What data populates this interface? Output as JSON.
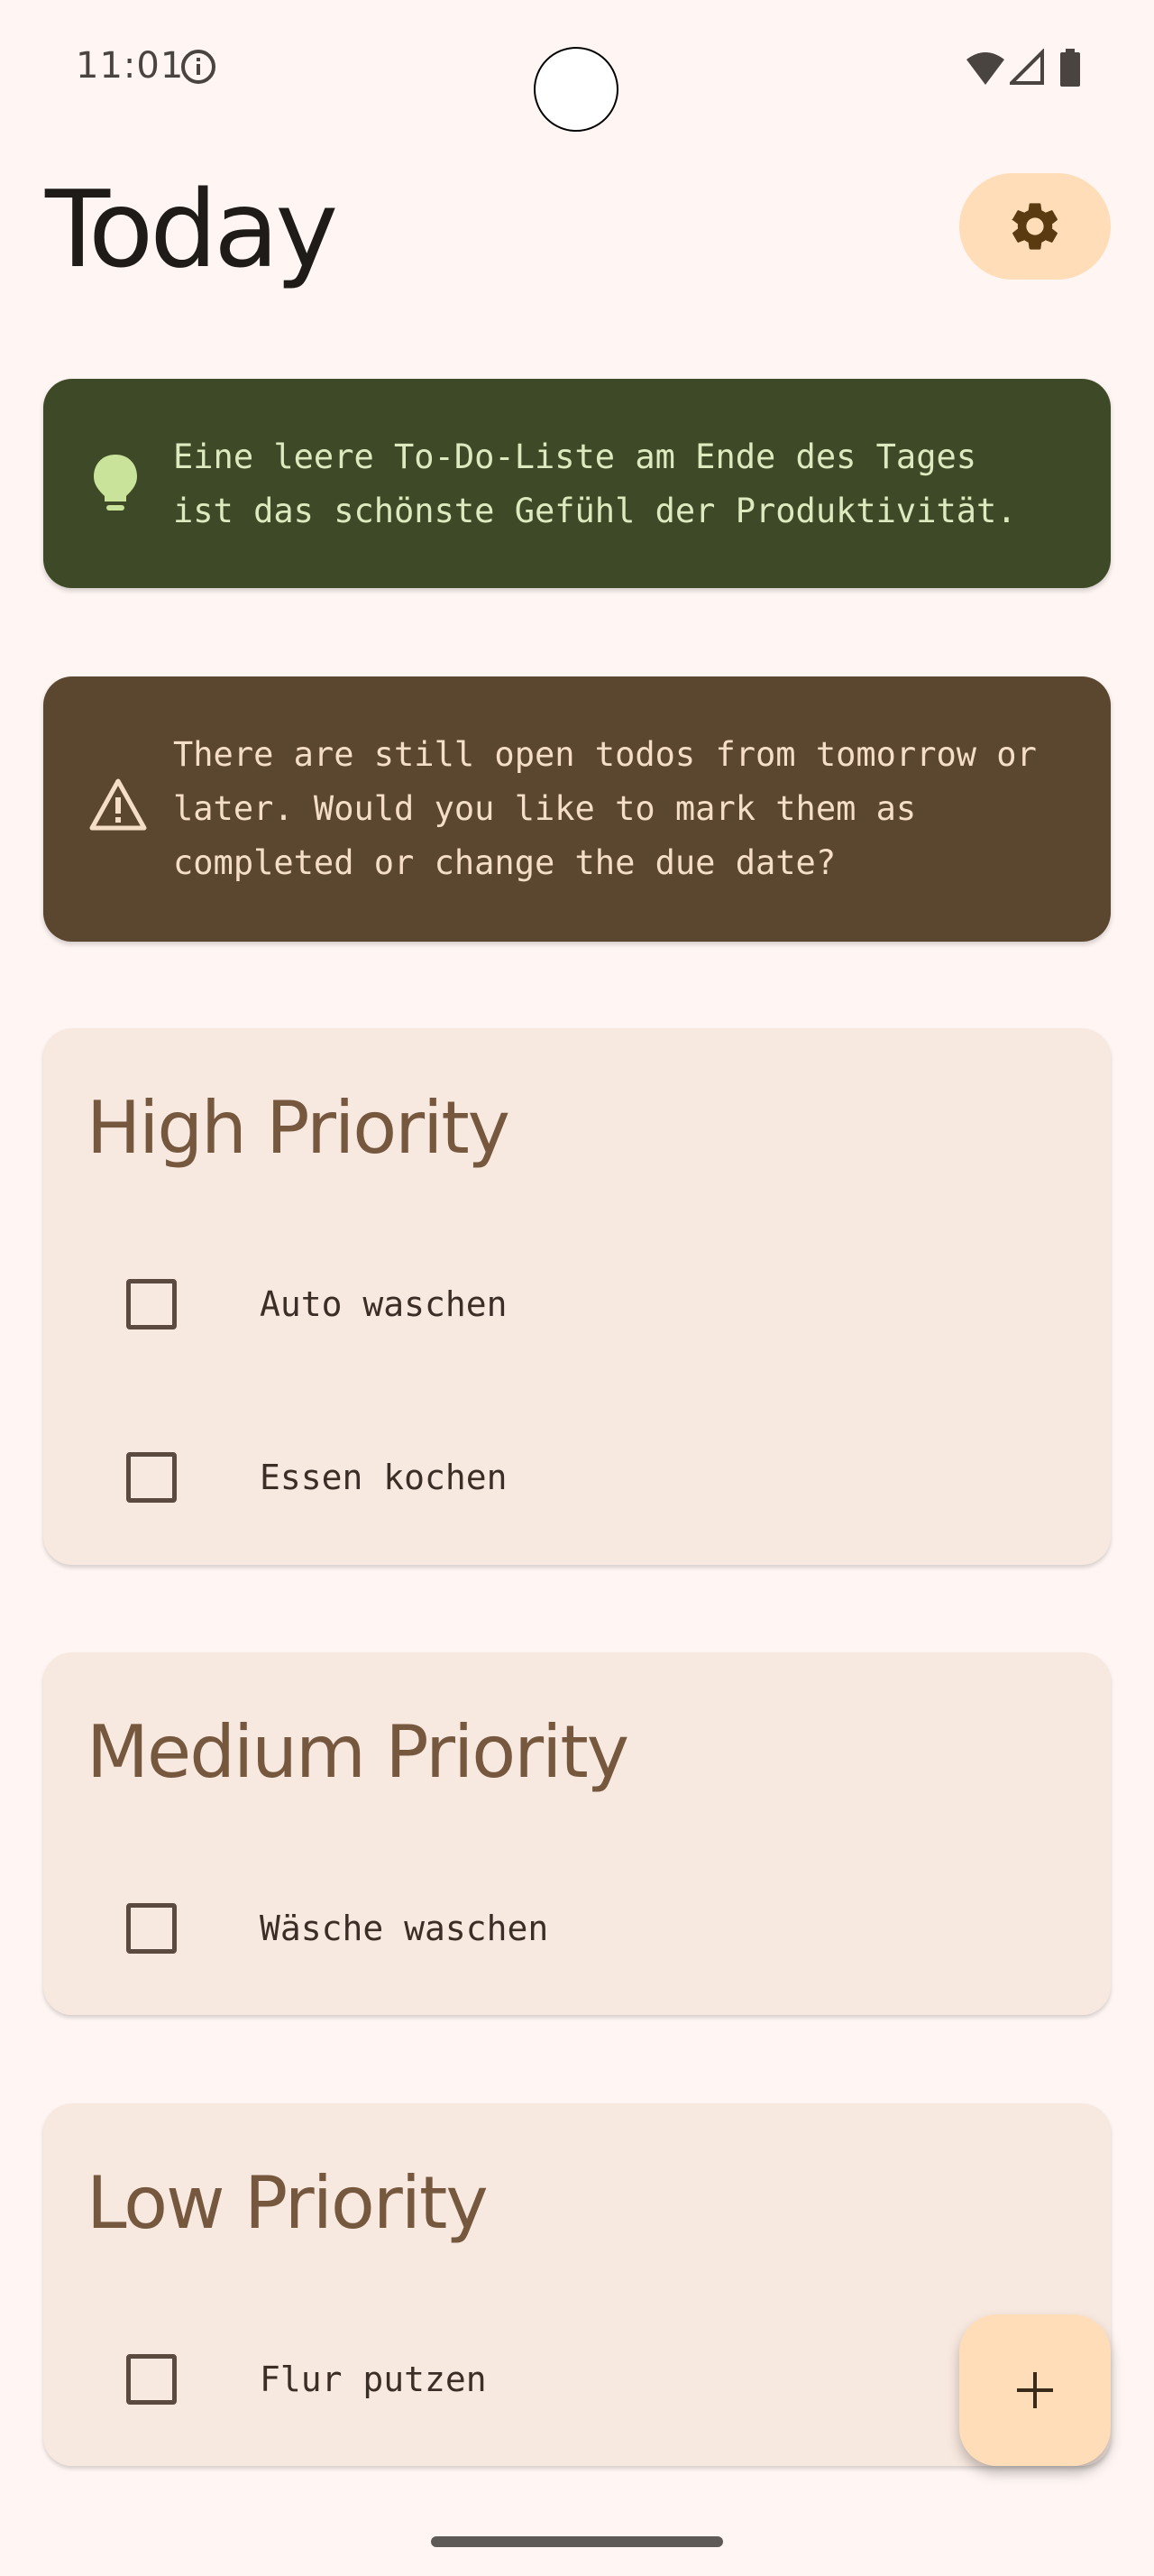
{
  "status_bar": {
    "time": "11:01"
  },
  "header": {
    "title": "Today"
  },
  "tip": {
    "text": "Eine leere To-Do-Liste am Ende des Tages ist das schönste Gefühl der Produktivität."
  },
  "warning": {
    "text": "There are still open todos from tomorrow or later. Would you like to mark them as completed or change the due date?"
  },
  "sections": [
    {
      "title": "High Priority",
      "items": [
        {
          "label": "Auto waschen",
          "checked": false
        },
        {
          "label": "Essen kochen",
          "checked": false
        }
      ]
    },
    {
      "title": "Medium Priority",
      "items": [
        {
          "label": "Wäsche waschen",
          "checked": false
        }
      ]
    },
    {
      "title": "Low Priority",
      "items": [
        {
          "label": "Flur putzen",
          "checked": false
        }
      ]
    }
  ],
  "icons": {
    "settings": "gear-icon",
    "tip": "lightbulb-icon",
    "warning": "warning-icon",
    "fab": "plus-icon"
  },
  "colors": {
    "background": "#FFF6F3",
    "tip_banner": "#3E4A27",
    "warning_banner": "#5B4630",
    "card": "#F8E9E0",
    "accent": "#FFDDB8",
    "section_title": "#76583F"
  }
}
